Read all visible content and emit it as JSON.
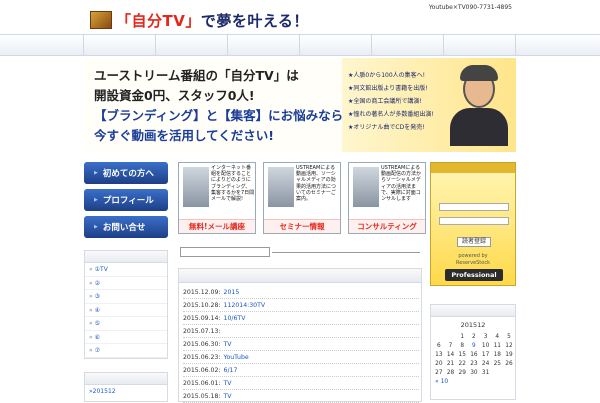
{
  "header": {
    "logo_prefix": "「自分TV」",
    "logo_suffix": "で夢を叶える！",
    "contact": "Youtube×TV090-7731-4895"
  },
  "hero": {
    "lines": [
      "ユーストリーム番組の「自分TV」は",
      "開設資金0円、スタッフ0人!",
      "【ブランディング】と【集客】にお悩みなら",
      "今すぐ動画を活用してください!"
    ],
    "bullets": [
      "★人脈0から100人の集客へ!",
      "★同文館出版より書籍を出版!",
      "★全国の商工会議所で講演!",
      "★憧れの著名人が多数番組出演!",
      "★オリジナル曲でCDを発売!"
    ]
  },
  "left_menu": [
    "初めての方へ",
    "プロフィール",
    "お問い合せ"
  ],
  "cards": [
    {
      "text": "インターネット番組を配信することによりどのようにブランディング、集客するかを7日間メールで解説!",
      "caption": "無料!メール講座"
    },
    {
      "text": "USTREAMによる動画活用、ソーシャルメディアの効果的活用方法についてのセミナーご案内。",
      "caption": "セミナー情報"
    },
    {
      "text": "USTREAMによる動画配信の方法からソーシャルメディアの活用法まで、実際に対面コンサルします",
      "caption": "コンサルティング"
    }
  ],
  "subscribe_box": {
    "button": "読者登録",
    "powered": "powered by",
    "reserve": "ReserveStock",
    "professional": "Professional"
  },
  "sidebar_links": [
    {
      "bullet": "»",
      "label": "①TV"
    },
    {
      "bullet": "»",
      "label": "②"
    },
    {
      "bullet": "»",
      "label": "③"
    },
    {
      "bullet": "»",
      "label": "④"
    },
    {
      "bullet": "»",
      "label": "⑤"
    },
    {
      "bullet": "»",
      "label": "⑥"
    },
    {
      "bullet": "»",
      "label": "⑦"
    }
  ],
  "archive": {
    "first": "»201512"
  },
  "news": [
    {
      "date": "2015.12.09:",
      "title": "2015"
    },
    {
      "date": "2015.10.28:",
      "title": "112014:30TV"
    },
    {
      "date": "2015.09.14:",
      "title": "10/6TV"
    },
    {
      "date": "2015.07.13:",
      "title": ""
    },
    {
      "date": "2015.06.30:",
      "title": "TV"
    },
    {
      "date": "2015.06.23:",
      "title": "YouTube"
    },
    {
      "date": "2015.06.02:",
      "title": "6/17"
    },
    {
      "date": "2015.06.01:",
      "title": "TV"
    },
    {
      "date": "2015.05.18:",
      "title": "TV"
    }
  ],
  "calendar": {
    "title": "201512",
    "rows": [
      [
        "",
        "",
        "1",
        "2",
        "3",
        "4",
        "5"
      ],
      [
        "6",
        "7",
        "8",
        "9",
        "10",
        "11",
        "12"
      ],
      [
        "13",
        "14",
        "15",
        "16",
        "17",
        "18",
        "19"
      ],
      [
        "20",
        "21",
        "22",
        "23",
        "24",
        "25",
        "26"
      ],
      [
        "27",
        "28",
        "29",
        "30",
        "31",
        "",
        ""
      ]
    ],
    "linked_days": [
      "9"
    ],
    "prev": "« 10"
  },
  "colors": {
    "brand_blue": "#1e3f86",
    "accent_red": "#e4271b",
    "link": "#1a56c8"
  }
}
